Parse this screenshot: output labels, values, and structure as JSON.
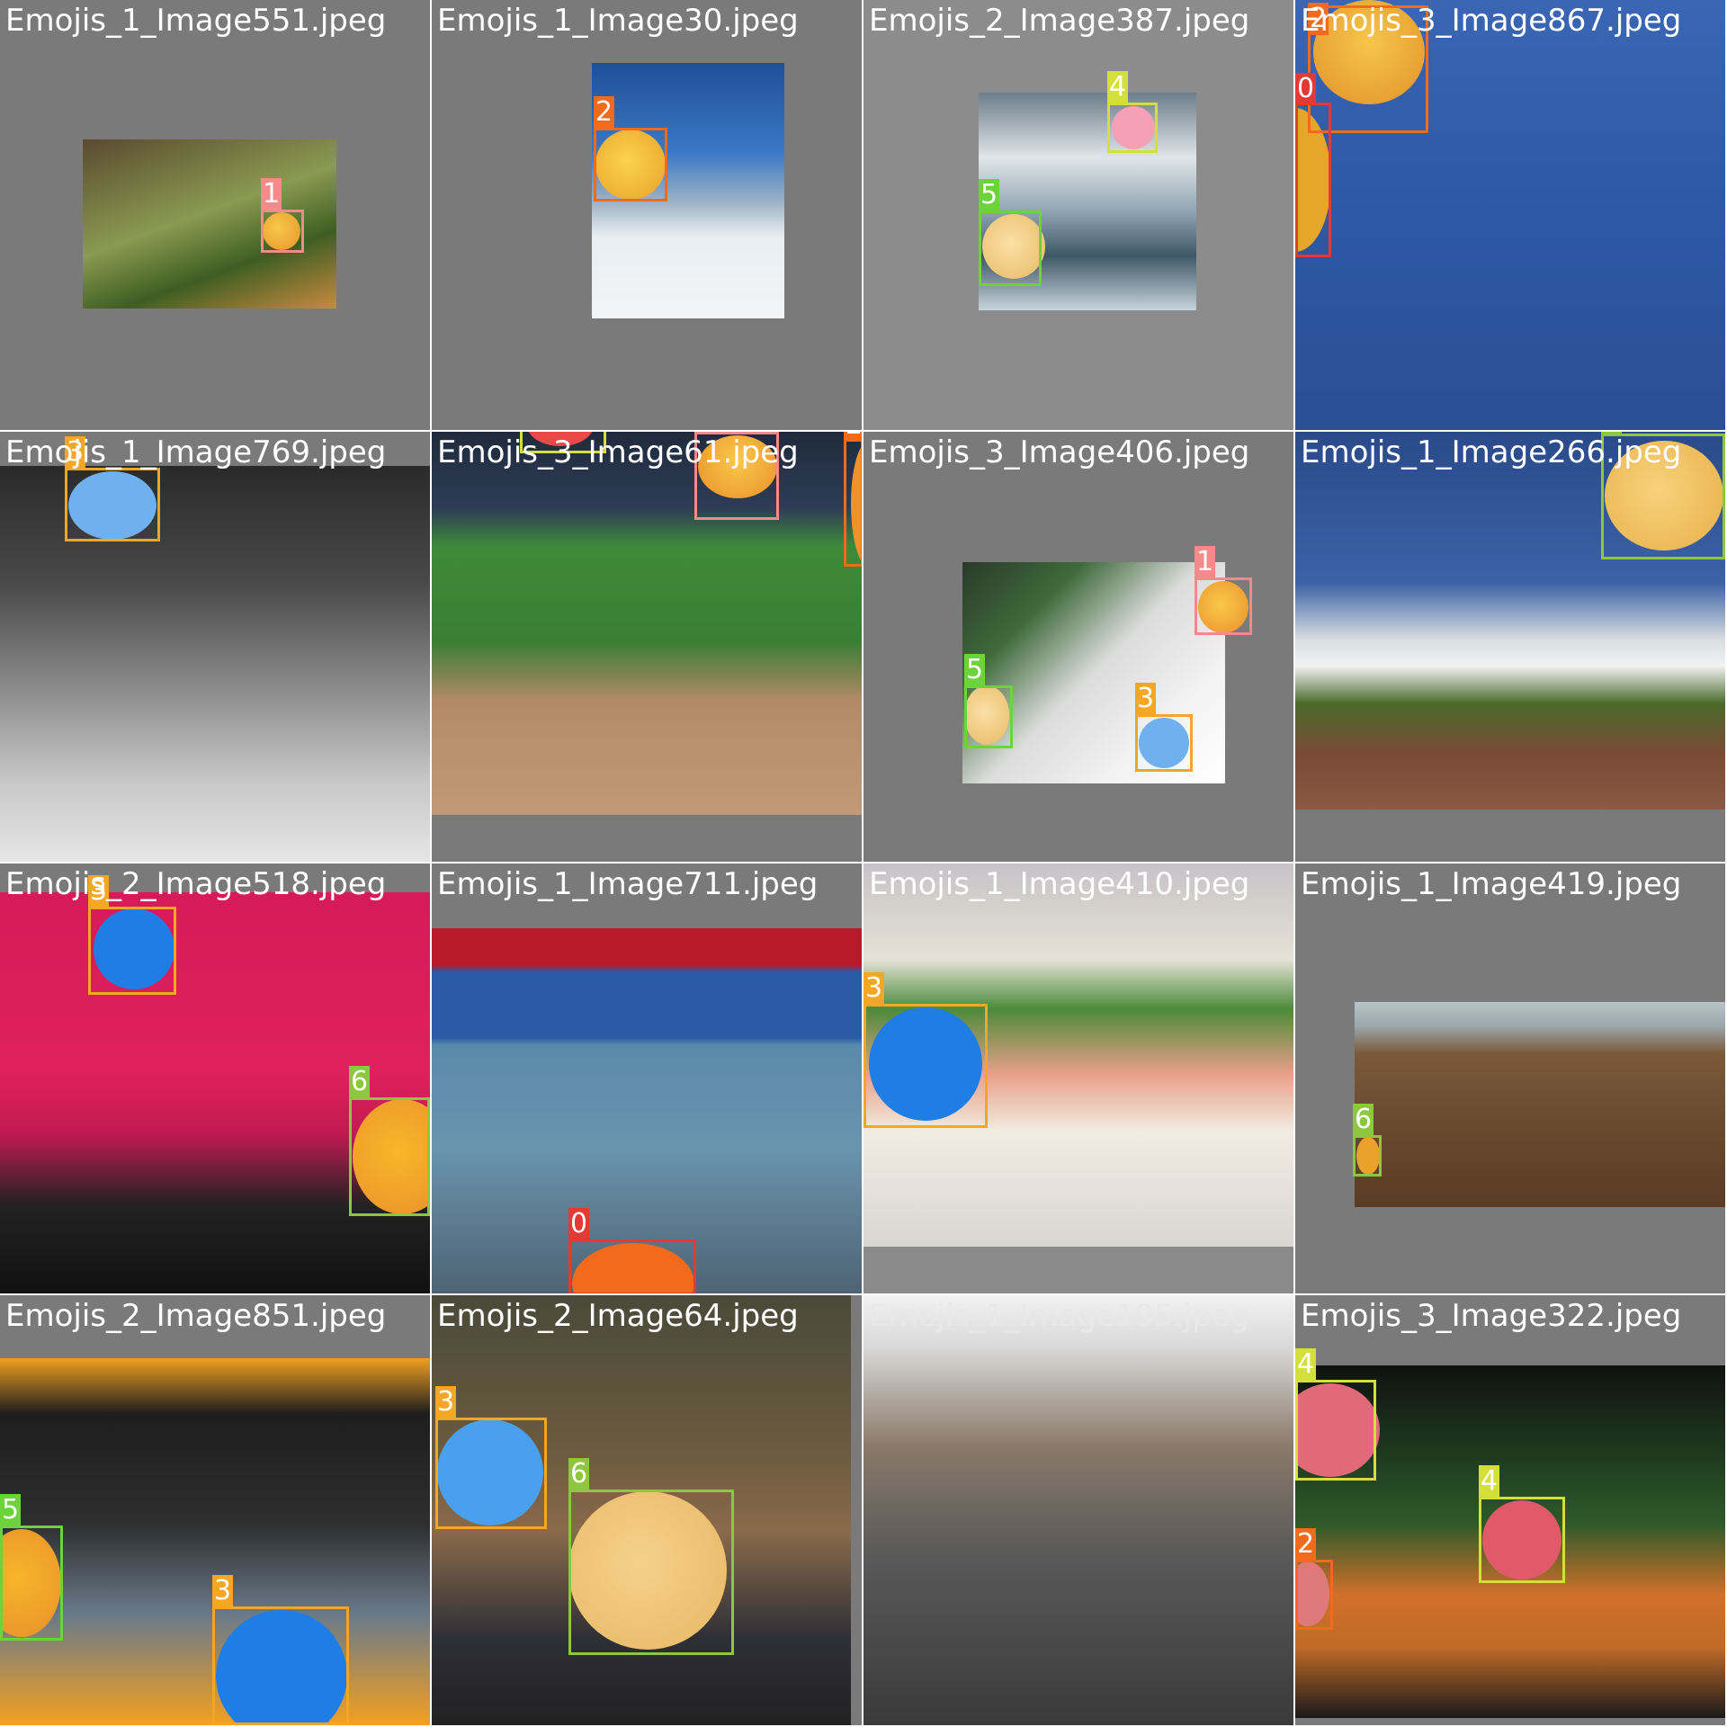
{
  "class_colors": {
    "0": "#e53935",
    "1": "#f48a8a",
    "2": "#f26a1b",
    "3": "#f5a623",
    "4": "#d4e03a",
    "5": "#6cd43a",
    "6": "#8dc63f"
  },
  "tiles": [
    {
      "filename": "Emojis_1_Image551.jpeg",
      "labels": [
        "1"
      ]
    },
    {
      "filename": "Emojis_1_Image30.jpeg",
      "labels": [
        "2"
      ]
    },
    {
      "filename": "Emojis_2_Image387.jpeg",
      "labels": [
        "4",
        "5"
      ]
    },
    {
      "filename": "Emojis_3_Image867.jpeg",
      "labels": [
        "2",
        "0"
      ]
    },
    {
      "filename": "Emojis_1_Image769.jpeg",
      "labels": [
        "3"
      ]
    },
    {
      "filename": "Emojis_3_Image61.jpeg",
      "labels": [
        "4",
        "1",
        "2"
      ]
    },
    {
      "filename": "Emojis_3_Image406.jpeg",
      "labels": [
        "1",
        "5",
        "3"
      ]
    },
    {
      "filename": "Emojis_1_Image266.jpeg",
      "labels": [
        "6"
      ]
    },
    {
      "filename": "Emojis_2_Image518.jpeg",
      "labels": [
        "3",
        "6"
      ]
    },
    {
      "filename": "Emojis_1_Image711.jpeg",
      "labels": [
        "0"
      ]
    },
    {
      "filename": "Emojis_1_Image410.jpeg",
      "labels": [
        "3"
      ]
    },
    {
      "filename": "Emojis_1_Image419.jpeg",
      "labels": [
        "6"
      ]
    },
    {
      "filename": "Emojis_2_Image851.jpeg",
      "labels": [
        "5",
        "3"
      ]
    },
    {
      "filename": "Emojis_2_Image64.jpeg",
      "labels": [
        "3",
        "6"
      ]
    },
    {
      "filename": "Emojis_1_Image195.jpeg",
      "labels": []
    },
    {
      "filename": "Emojis_3_Image322.jpeg",
      "labels": [
        "4",
        "2",
        "4"
      ]
    }
  ]
}
